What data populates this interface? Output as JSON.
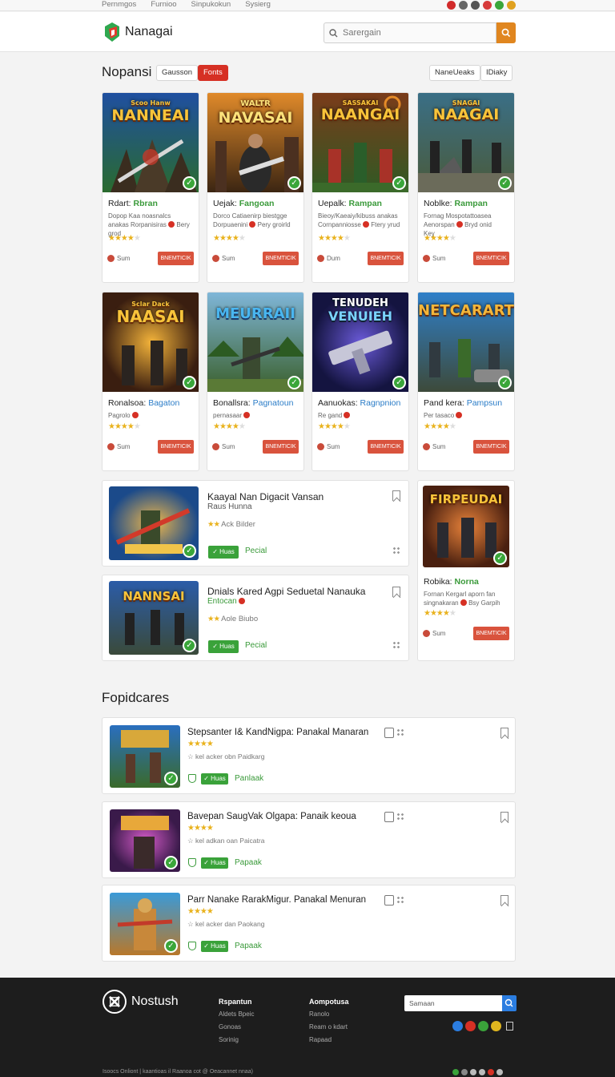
{
  "topbar": {
    "links": [
      "Pernmgos",
      "Furnioo",
      "Sinpukokun",
      "Sysierg"
    ],
    "dots": [
      "#d12b2b",
      "#666666",
      "#555555",
      "#d63a3a",
      "#3aa63a",
      "#e0a11f"
    ]
  },
  "header": {
    "brand": "Nanagai",
    "search_placeholder": "Sarergain"
  },
  "section1": {
    "title": "Nopansi",
    "chip1": "Gausson",
    "chip2": "Fonts",
    "chip3": "NaneUeaks",
    "chip4": "IDiaky"
  },
  "cards": [
    {
      "art_title": "NANNEAI",
      "art_sub": "Scoo Hanw",
      "title": "Rdart:",
      "accent": "Rbran",
      "desc": "Dopop Kaa noasnalcs anakas Rorpanisiras",
      "desc_tail": "Bery grod",
      "like": "Sum",
      "btn": "BNEMTICIK",
      "stars": 4
    },
    {
      "art_title": "NAVASAI",
      "art_sub": "WALTR",
      "title": "Uejak:",
      "accent": "Fangoan",
      "desc": "Dorco Catiaenirp biestgge Dorpuaenini",
      "desc_tail": "Pery groirld",
      "like": "Sum",
      "btn": "BNEMTICIK",
      "stars": 4
    },
    {
      "art_title": "NAANGAI",
      "art_sub": "SASSAKAI",
      "title": "Uepalk:",
      "accent": "Rampan",
      "desc": "Bieoy/Kaeaiy/kibuss anakas Cornpanniosse",
      "desc_tail": "Ftery yrud",
      "like": "Dum",
      "btn": "BNEMTICIK",
      "stars": 4
    },
    {
      "art_title": "NAAGAI",
      "art_sub": "SNAGAI",
      "title": "Noblke:",
      "accent": "Rampan",
      "desc": "Fornag Mospotattoasea Aenorspan",
      "desc_tail": "Bryd onid",
      "desc2": "Key",
      "like": "Sum",
      "btn": "BNEMTICIK",
      "stars": 4
    },
    {
      "art_title": "NAASAI",
      "art_sub": "Sclar Dack",
      "title": "Ronalsoa:",
      "accent": "Bagaton",
      "desc": "Pagrolo",
      "like": "Sum",
      "btn": "BNEMTICIK",
      "stars": 4
    },
    {
      "art_title": "MEURRAII",
      "art_sub": "",
      "title": "Bonallsra:",
      "accent": "Pagnatoun",
      "desc": "pernasaar",
      "like": "Sum",
      "btn": "BNEMTICIK",
      "stars": 4
    },
    {
      "art_title": "TENUDEH",
      "art_sub": "VENUIEH",
      "title": "Aanuokas:",
      "accent": "Ragnpnion",
      "desc": "Re gand",
      "like": "Sum",
      "btn": "BNEMTICIK",
      "stars": 4
    },
    {
      "art_title": "NETCARART",
      "art_sub": "",
      "title": "Pand kera:",
      "accent": "Pampsun",
      "desc": "Per tasaco",
      "like": "Sum",
      "btn": "BNEMTICIK",
      "stars": 4
    }
  ],
  "wide_items": [
    {
      "title": "Kaayal Nan Digacit Vansan",
      "sub": "Raus Hunna",
      "rate_label": "Ack Bilder",
      "btn": "Huas",
      "link": "Pecial"
    },
    {
      "title": "Dnials Kared Agpi Seduetal Nanauka",
      "sub": "Entocan",
      "rate_label": "Aole Biubo",
      "btn": "Huas",
      "link": "Pecial"
    }
  ],
  "side_card": {
    "art_title": "FIRPEUDAI",
    "title": "Robika:",
    "accent": "Norna",
    "desc": "Fornan Kergarl aporn fan singnakaran",
    "desc_tail": "Bsy Garpih",
    "like": "Sum",
    "btn": "BNEMTICIK",
    "stars": 4
  },
  "section2": {
    "title": "Fopidcares"
  },
  "list_items": [
    {
      "title": "Stepsanter I& KandNigpa: Panakal Manaran",
      "meta": "kel acker obn Paidkarg",
      "btn": "Huas",
      "link": "Panlaak"
    },
    {
      "title": "Bavepan SaugVak Olgapa: Panaik keoua",
      "meta": "kel adkan oan Paicatra",
      "btn": "Huas",
      "link": "Papaak"
    },
    {
      "title": "Parr Nanake RarakMigur. Panakal Menuran",
      "meta": "kel acker dan Paokang",
      "btn": "Huas",
      "link": "Papaak"
    }
  ],
  "footer": {
    "brand": "Nostush",
    "col1_head": "Rspantun",
    "col1": [
      "Aldets Bpeic",
      "Gonoas",
      "Sorinig"
    ],
    "col2_head": "Aompotusa",
    "col2": [
      "Ranolo",
      "Ream o kdart",
      "Rapaad"
    ],
    "search_placeholder": "Samaan",
    "copyright": "Isoocs Onliont | kaantioas il Raanoa cot @ Oeacannet nnaa)"
  }
}
